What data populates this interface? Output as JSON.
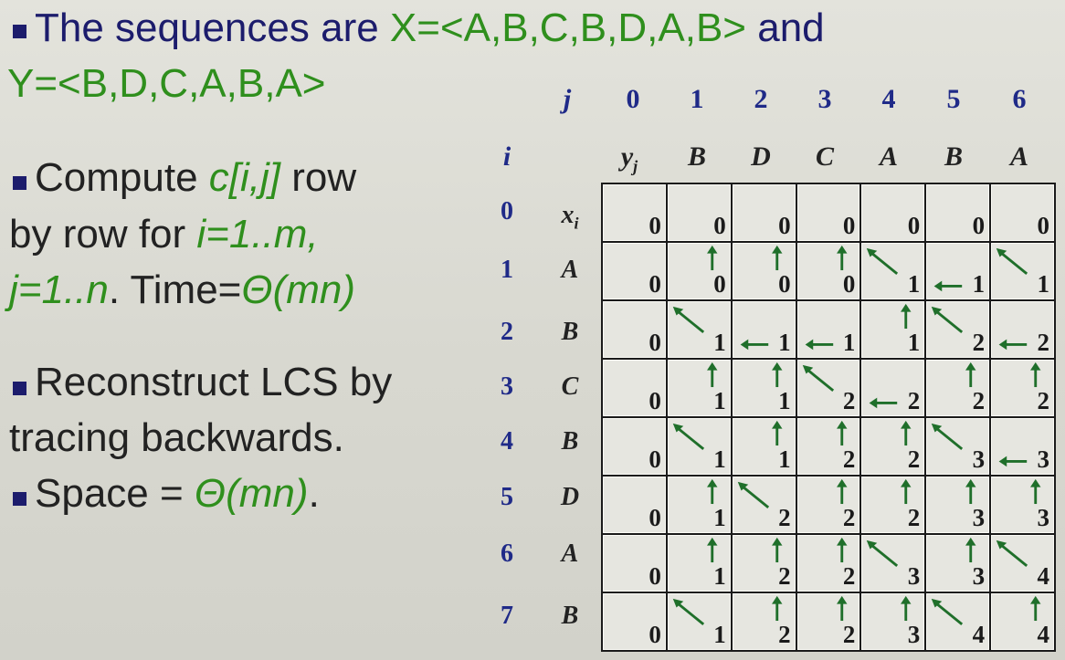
{
  "bullets": {
    "b1": {
      "pre": "The sequences are ",
      "x": "X=<A,B,C,B,D,A,B>",
      "mid": " and",
      "y": "Y=<B,D,C,A,B,A>"
    },
    "b2": {
      "pre": "Compute ",
      "c": "c[i,j]",
      "post": " row",
      "l2pre": "by row for ",
      "i": "i=1..m,",
      "j": "j=1..n",
      "time": ". Time=",
      "theta": "Θ(mn)"
    },
    "b3": {
      "l1": "Reconstruct LCS by",
      "l2": "tracing backwards."
    },
    "b4": {
      "pre": "Space = ",
      "theta": "Θ(mn)",
      "post": "."
    }
  },
  "table": {
    "j_label": "j",
    "i_label": "i",
    "j_values": [
      "0",
      "1",
      "2",
      "3",
      "4",
      "5",
      "6"
    ],
    "y_label": "y",
    "y_sub": "j",
    "y_values": [
      "B",
      "D",
      "C",
      "A",
      "B",
      "A"
    ],
    "i_values": [
      "0",
      "1",
      "2",
      "3",
      "4",
      "5",
      "6",
      "7"
    ],
    "x_label": "x",
    "x_sub": "i",
    "x_values": [
      "A",
      "B",
      "C",
      "B",
      "D",
      "A",
      "B"
    ],
    "rows": [
      [
        {
          "v": "0"
        },
        {
          "v": "0"
        },
        {
          "v": "0"
        },
        {
          "v": "0"
        },
        {
          "v": "0"
        },
        {
          "v": "0"
        },
        {
          "v": "0"
        }
      ],
      [
        {
          "v": "0"
        },
        {
          "v": "0",
          "a": "up"
        },
        {
          "v": "0",
          "a": "up"
        },
        {
          "v": "0",
          "a": "up"
        },
        {
          "v": "1",
          "a": "diag"
        },
        {
          "v": "1",
          "a": "left"
        },
        {
          "v": "1",
          "a": "diag"
        }
      ],
      [
        {
          "v": "0"
        },
        {
          "v": "1",
          "a": "diag"
        },
        {
          "v": "1",
          "a": "left"
        },
        {
          "v": "1",
          "a": "left"
        },
        {
          "v": "1",
          "a": "up"
        },
        {
          "v": "2",
          "a": "diag"
        },
        {
          "v": "2",
          "a": "left"
        }
      ],
      [
        {
          "v": "0"
        },
        {
          "v": "1",
          "a": "up"
        },
        {
          "v": "1",
          "a": "up"
        },
        {
          "v": "2",
          "a": "diag"
        },
        {
          "v": "2",
          "a": "left"
        },
        {
          "v": "2",
          "a": "up"
        },
        {
          "v": "2",
          "a": "up"
        }
      ],
      [
        {
          "v": "0"
        },
        {
          "v": "1",
          "a": "diag"
        },
        {
          "v": "1",
          "a": "up"
        },
        {
          "v": "2",
          "a": "up"
        },
        {
          "v": "2",
          "a": "up"
        },
        {
          "v": "3",
          "a": "diag"
        },
        {
          "v": "3",
          "a": "left"
        }
      ],
      [
        {
          "v": "0"
        },
        {
          "v": "1",
          "a": "up"
        },
        {
          "v": "2",
          "a": "diag"
        },
        {
          "v": "2",
          "a": "up"
        },
        {
          "v": "2",
          "a": "up"
        },
        {
          "v": "3",
          "a": "up"
        },
        {
          "v": "3",
          "a": "up"
        }
      ],
      [
        {
          "v": "0"
        },
        {
          "v": "1",
          "a": "up"
        },
        {
          "v": "2",
          "a": "up"
        },
        {
          "v": "2",
          "a": "up"
        },
        {
          "v": "3",
          "a": "diag"
        },
        {
          "v": "3",
          "a": "up"
        },
        {
          "v": "4",
          "a": "diag"
        }
      ],
      [
        {
          "v": "0"
        },
        {
          "v": "1",
          "a": "diag"
        },
        {
          "v": "2",
          "a": "up"
        },
        {
          "v": "2",
          "a": "up"
        },
        {
          "v": "3",
          "a": "up"
        },
        {
          "v": "4",
          "a": "diag"
        },
        {
          "v": "4",
          "a": "up"
        }
      ]
    ]
  },
  "colors": {
    "navy": "#1c1c6c",
    "green": "#2f8f1d",
    "arrow": "#1f6f2a",
    "bullet": "#1c1c6c"
  }
}
